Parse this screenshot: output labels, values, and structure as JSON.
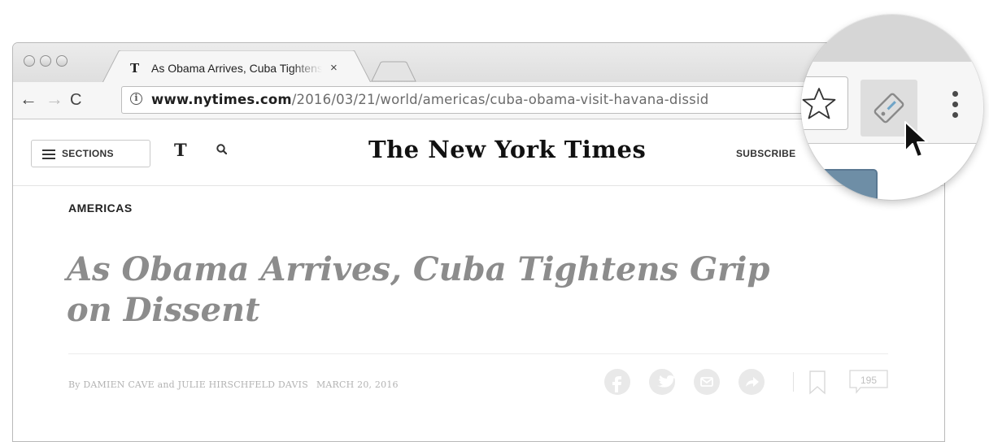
{
  "browser": {
    "tab": {
      "favicon": "T",
      "title": "As Obama Arrives, Cuba Tightens Grip on Dissent",
      "close": "×"
    },
    "nav": {
      "back": "←",
      "forward": "→",
      "reload": "C"
    },
    "omnibox": {
      "info": "i",
      "host": "www.nytimes.com",
      "path": "/2016/03/21/world/americas/cuba-obama-visit-havana-dissid"
    }
  },
  "page": {
    "sections_label": "SECTIONS",
    "t_logo": "T",
    "masthead": "The New York Times",
    "subscribe": "SUBSCRIBE",
    "kicker": "AMERICAS",
    "headline": "As Obama Arrives, Cuba Tightens Grip on Dissent",
    "byline": "By DAMIEN CAVE and JULIE HIRSCHFELD DAVIS",
    "date": "MARCH 20, 2016",
    "comment_count": "195"
  },
  "icons": {
    "share": [
      "facebook-icon",
      "twitter-icon",
      "email-icon",
      "share-icon"
    ],
    "magnifier": [
      "star-icon",
      "extension-icon",
      "menu-icon",
      "cursor-icon"
    ]
  },
  "colors": {
    "headline": "#8c8c8c",
    "chrome": "#dcdcdc",
    "extension_popup": "#6e8ea6"
  }
}
